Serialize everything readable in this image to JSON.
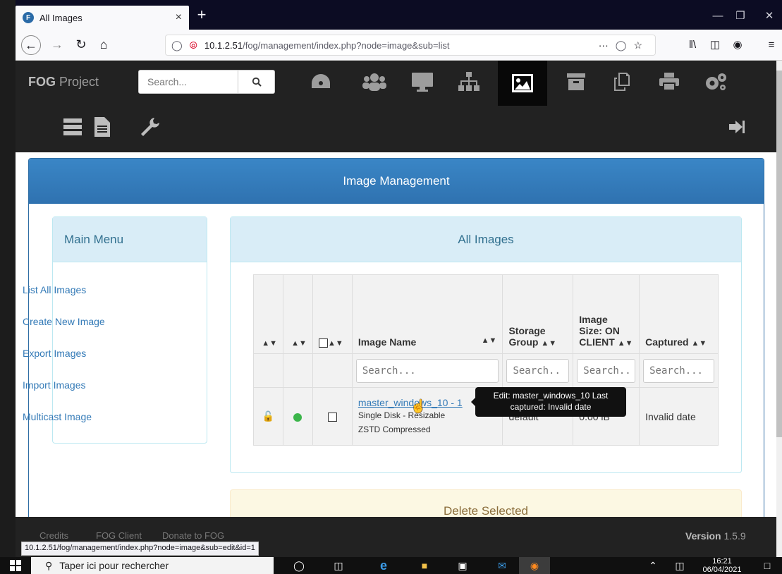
{
  "browser": {
    "tab_title": "All Images",
    "tab_close": "×",
    "new_tab": "+",
    "url_host": "10.1.2.51",
    "url_path": "/fog/management/index.php?node=image&sub=list",
    "url_more": "···",
    "status_url": "10.1.2.51/fog/management/index.php?node=image&sub=edit&id=1"
  },
  "header": {
    "brand_bold": "FOG",
    "brand_rest": " Project",
    "search_placeholder": "Search..."
  },
  "page": {
    "title": "Image Management"
  },
  "menu": {
    "title": "Main Menu",
    "items": [
      "List All Images",
      "Create New Image",
      "Export Images",
      "Import Images",
      "Multicast Image"
    ]
  },
  "images": {
    "title": "All Images",
    "columns": {
      "name": "Image Name",
      "storage": "Storage Group",
      "size": "Image Size: ON CLIENT",
      "captured": "Captured"
    },
    "filter_placeholder": "Search...",
    "rows": [
      {
        "name": "master_windows_10 - 1",
        "sub1": "Single Disk - Resizable",
        "sub2": "ZSTD Compressed",
        "storage": "default",
        "size": "0.00 iB",
        "captured": "Invalid date"
      }
    ],
    "tooltip": "Edit: master_windows_10 Last captured: Invalid date",
    "delete_label": "Delete Selected"
  },
  "footer": {
    "links": [
      "Credits",
      "FOG Client",
      "Donate to FOG"
    ],
    "version_label": "Version",
    "version_value": "1.5.9"
  },
  "taskbar": {
    "search_placeholder": "Taper ici pour rechercher",
    "time": "16:21",
    "date": "06/04/2021"
  },
  "colors": {
    "primary": "#337ab7",
    "header_bg": "#222222",
    "info_bg": "#d9edf7",
    "warning_bg": "#fcf8e3"
  }
}
